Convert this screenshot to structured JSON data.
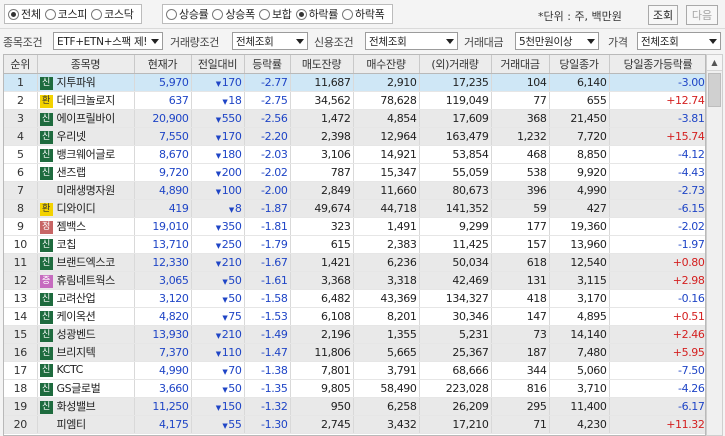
{
  "market_options": [
    {
      "label": "전체",
      "checked": true
    },
    {
      "label": "코스피",
      "checked": false
    },
    {
      "label": "코스닥",
      "checked": false
    }
  ],
  "sort_options": [
    {
      "label": "상승률",
      "checked": false
    },
    {
      "label": "상승폭",
      "checked": false
    },
    {
      "label": "보합",
      "checked": false
    },
    {
      "label": "하락률",
      "checked": true
    },
    {
      "label": "하락폭",
      "checked": false
    }
  ],
  "unit_text": "*단위 : 주, 백만원",
  "buttons": {
    "query": "조회",
    "next": "다음"
  },
  "filters": {
    "stock_condition_label": "종목조건",
    "stock_condition_value": "ETF+ETN+스팩 제!",
    "volume_condition_label": "거래량조건",
    "volume_condition_value": "전체조회",
    "credit_condition_label": "신용조건",
    "credit_condition_value": "전체조회",
    "trade_amount_label": "거래대금",
    "trade_amount_value": "5천만원이상",
    "price_label": "가격",
    "price_value": "전체조회"
  },
  "columns": [
    "순위",
    "종목명",
    "현재가",
    "전일대비",
    "등락률",
    "매도잔량",
    "매수잔량",
    "(외)거래량",
    "거래대금",
    "당일종가",
    "당일종가등락률"
  ],
  "rows": [
    {
      "rank": "1",
      "tag": "신",
      "tag_type": "sin",
      "name": "지투파워",
      "price": "5,970",
      "diff": "170",
      "rate": "-2.77",
      "ask": "11,687",
      "bid": "2,910",
      "volume": "17,235",
      "amount": "104",
      "close": "6,140",
      "close_rate": "-3.00",
      "close_dir": "down"
    },
    {
      "rank": "2",
      "tag": "환",
      "tag_type": "hwan",
      "name": "더테크놀로지",
      "price": "637",
      "diff": "18",
      "rate": "-2.75",
      "ask": "34,562",
      "bid": "78,628",
      "volume": "119,049",
      "amount": "77",
      "close": "655",
      "close_rate": "+12.74",
      "close_dir": "up"
    },
    {
      "rank": "3",
      "tag": "신",
      "tag_type": "sin",
      "name": "에이프릴바이",
      "price": "20,900",
      "diff": "550",
      "rate": "-2.56",
      "ask": "1,472",
      "bid": "4,854",
      "volume": "17,609",
      "amount": "368",
      "close": "21,450",
      "close_rate": "-3.81",
      "close_dir": "down"
    },
    {
      "rank": "4",
      "tag": "신",
      "tag_type": "sin",
      "name": "우리넷",
      "price": "7,550",
      "diff": "170",
      "rate": "-2.20",
      "ask": "2,398",
      "bid": "12,964",
      "volume": "163,479",
      "amount": "1,232",
      "close": "7,720",
      "close_rate": "+15.74",
      "close_dir": "up"
    },
    {
      "rank": "5",
      "tag": "신",
      "tag_type": "sin",
      "name": "뱅크웨어글로",
      "price": "8,670",
      "diff": "180",
      "rate": "-2.03",
      "ask": "3,106",
      "bid": "14,921",
      "volume": "53,854",
      "amount": "468",
      "close": "8,850",
      "close_rate": "-4.12",
      "close_dir": "down"
    },
    {
      "rank": "6",
      "tag": "신",
      "tag_type": "sin",
      "name": "샌즈랩",
      "price": "9,720",
      "diff": "200",
      "rate": "-2.02",
      "ask": "787",
      "bid": "15,347",
      "volume": "55,059",
      "amount": "538",
      "close": "9,920",
      "close_rate": "-4.43",
      "close_dir": "down"
    },
    {
      "rank": "7",
      "tag": "",
      "tag_type": "none",
      "name": "미래생명자원",
      "price": "4,890",
      "diff": "100",
      "rate": "-2.00",
      "ask": "2,849",
      "bid": "11,660",
      "volume": "80,673",
      "amount": "396",
      "close": "4,990",
      "close_rate": "-2.73",
      "close_dir": "down"
    },
    {
      "rank": "8",
      "tag": "환",
      "tag_type": "hwan",
      "name": "디와이디",
      "price": "419",
      "diff": "8",
      "rate": "-1.87",
      "ask": "49,674",
      "bid": "44,718",
      "volume": "141,352",
      "amount": "59",
      "close": "427",
      "close_rate": "-6.15",
      "close_dir": "down"
    },
    {
      "rank": "9",
      "tag": "정",
      "tag_type": "jeom",
      "name": "젬백스",
      "price": "19,010",
      "diff": "350",
      "rate": "-1.81",
      "ask": "323",
      "bid": "1,491",
      "volume": "9,299",
      "amount": "177",
      "close": "19,360",
      "close_rate": "-2.02",
      "close_dir": "down"
    },
    {
      "rank": "10",
      "tag": "신",
      "tag_type": "sin",
      "name": "코칩",
      "price": "13,710",
      "diff": "250",
      "rate": "-1.79",
      "ask": "615",
      "bid": "2,383",
      "volume": "11,425",
      "amount": "157",
      "close": "13,960",
      "close_rate": "-1.97",
      "close_dir": "down"
    },
    {
      "rank": "11",
      "tag": "신",
      "tag_type": "sin",
      "name": "브랜드엑스코",
      "price": "12,330",
      "diff": "210",
      "rate": "-1.67",
      "ask": "1,421",
      "bid": "6,236",
      "volume": "50,034",
      "amount": "618",
      "close": "12,540",
      "close_rate": "+0.80",
      "close_dir": "up"
    },
    {
      "rank": "12",
      "tag": "증",
      "tag_type": "jeung",
      "name": "휴림네트웍스",
      "price": "3,065",
      "diff": "50",
      "rate": "-1.61",
      "ask": "3,368",
      "bid": "3,318",
      "volume": "42,469",
      "amount": "131",
      "close": "3,115",
      "close_rate": "+2.98",
      "close_dir": "up"
    },
    {
      "rank": "13",
      "tag": "신",
      "tag_type": "sin",
      "name": "고려산업",
      "price": "3,120",
      "diff": "50",
      "rate": "-1.58",
      "ask": "6,482",
      "bid": "43,369",
      "volume": "134,327",
      "amount": "418",
      "close": "3,170",
      "close_rate": "-0.16",
      "close_dir": "down"
    },
    {
      "rank": "14",
      "tag": "신",
      "tag_type": "sin",
      "name": "케이옥션",
      "price": "4,820",
      "diff": "75",
      "rate": "-1.53",
      "ask": "6,108",
      "bid": "8,201",
      "volume": "30,346",
      "amount": "147",
      "close": "4,895",
      "close_rate": "+0.51",
      "close_dir": "up"
    },
    {
      "rank": "15",
      "tag": "신",
      "tag_type": "sin",
      "name": "성광벤드",
      "price": "13,930",
      "diff": "210",
      "rate": "-1.49",
      "ask": "2,196",
      "bid": "1,355",
      "volume": "5,231",
      "amount": "73",
      "close": "14,140",
      "close_rate": "+2.46",
      "close_dir": "up"
    },
    {
      "rank": "16",
      "tag": "신",
      "tag_type": "sin",
      "name": "브리지텍",
      "price": "7,370",
      "diff": "110",
      "rate": "-1.47",
      "ask": "11,806",
      "bid": "5,665",
      "volume": "25,367",
      "amount": "187",
      "close": "7,480",
      "close_rate": "+5.95",
      "close_dir": "up"
    },
    {
      "rank": "17",
      "tag": "신",
      "tag_type": "sin",
      "name": "KCTC",
      "price": "4,990",
      "diff": "70",
      "rate": "-1.38",
      "ask": "7,801",
      "bid": "3,791",
      "volume": "68,666",
      "amount": "344",
      "close": "5,060",
      "close_rate": "-7.50",
      "close_dir": "down"
    },
    {
      "rank": "18",
      "tag": "신",
      "tag_type": "sin",
      "name": "GS글로벌",
      "price": "3,660",
      "diff": "50",
      "rate": "-1.35",
      "ask": "9,805",
      "bid": "58,490",
      "volume": "223,028",
      "amount": "816",
      "close": "3,710",
      "close_rate": "-4.26",
      "close_dir": "down"
    },
    {
      "rank": "19",
      "tag": "신",
      "tag_type": "sin",
      "name": "화성밸브",
      "price": "11,250",
      "diff": "150",
      "rate": "-1.32",
      "ask": "950",
      "bid": "6,258",
      "volume": "26,209",
      "amount": "295",
      "close": "11,400",
      "close_rate": "-6.17",
      "close_dir": "down"
    },
    {
      "rank": "20",
      "tag": "",
      "tag_type": "none",
      "name": "피엠티",
      "price": "4,175",
      "diff": "55",
      "rate": "-1.30",
      "ask": "2,745",
      "bid": "3,432",
      "volume": "17,210",
      "amount": "71",
      "close": "4,230",
      "close_rate": "+11.32",
      "close_dir": "up"
    }
  ],
  "colors": {
    "up": "#d42020",
    "down": "#1f45c6",
    "selected_row": "#cfe7f6",
    "band_row": "#e9e9e9",
    "tag_sin": "#1e6b3e",
    "tag_hwan": "#f3d200",
    "tag_jeom": "#c76565",
    "tag_jeung": "#c66bbf"
  },
  "icons": {
    "scroll_up": "chevron-up-icon",
    "scroll_down": "chevron-down-icon",
    "dropdown": "caret-down-icon"
  }
}
